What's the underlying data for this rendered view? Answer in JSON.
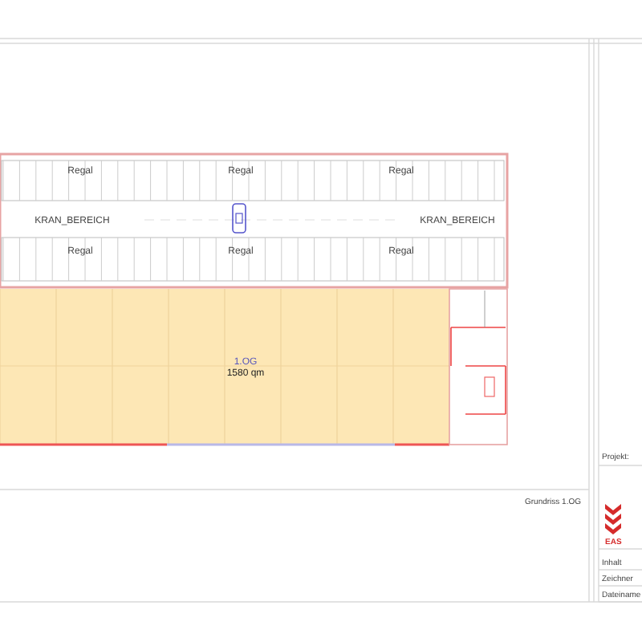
{
  "plan": {
    "top_rack_labels": [
      "Regal",
      "Regal",
      "Regal"
    ],
    "crane_labels": [
      "KRAN_BEREICH",
      "KRAN_BEREICH"
    ],
    "bottom_rack_labels": [
      "Regal",
      "Regal",
      "Regal"
    ],
    "area": {
      "name": "1.OG",
      "size": "1580 qm"
    }
  },
  "sheet_caption": "Grundriss 1.OG",
  "title_block": {
    "project_label": "Projekt:",
    "logo": "EAS",
    "rows": [
      "Inhalt",
      "Zeichner",
      "Dateiname"
    ]
  }
}
